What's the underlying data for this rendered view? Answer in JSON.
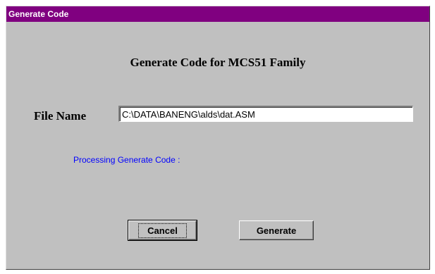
{
  "window": {
    "title": "Generate Code"
  },
  "main": {
    "heading": "Generate Code for MCS51 Family",
    "file_name_label": "File Name",
    "file_name_value": "C:\\DATA\\BANENG\\alds\\dat.ASM",
    "status_text": "Processing Generate Code :"
  },
  "buttons": {
    "cancel_label": "Cancel",
    "generate_label": "Generate"
  },
  "colors": {
    "titlebar": "#800080",
    "dialog_bg": "#c0c0c0",
    "status_text": "#0000ff"
  }
}
